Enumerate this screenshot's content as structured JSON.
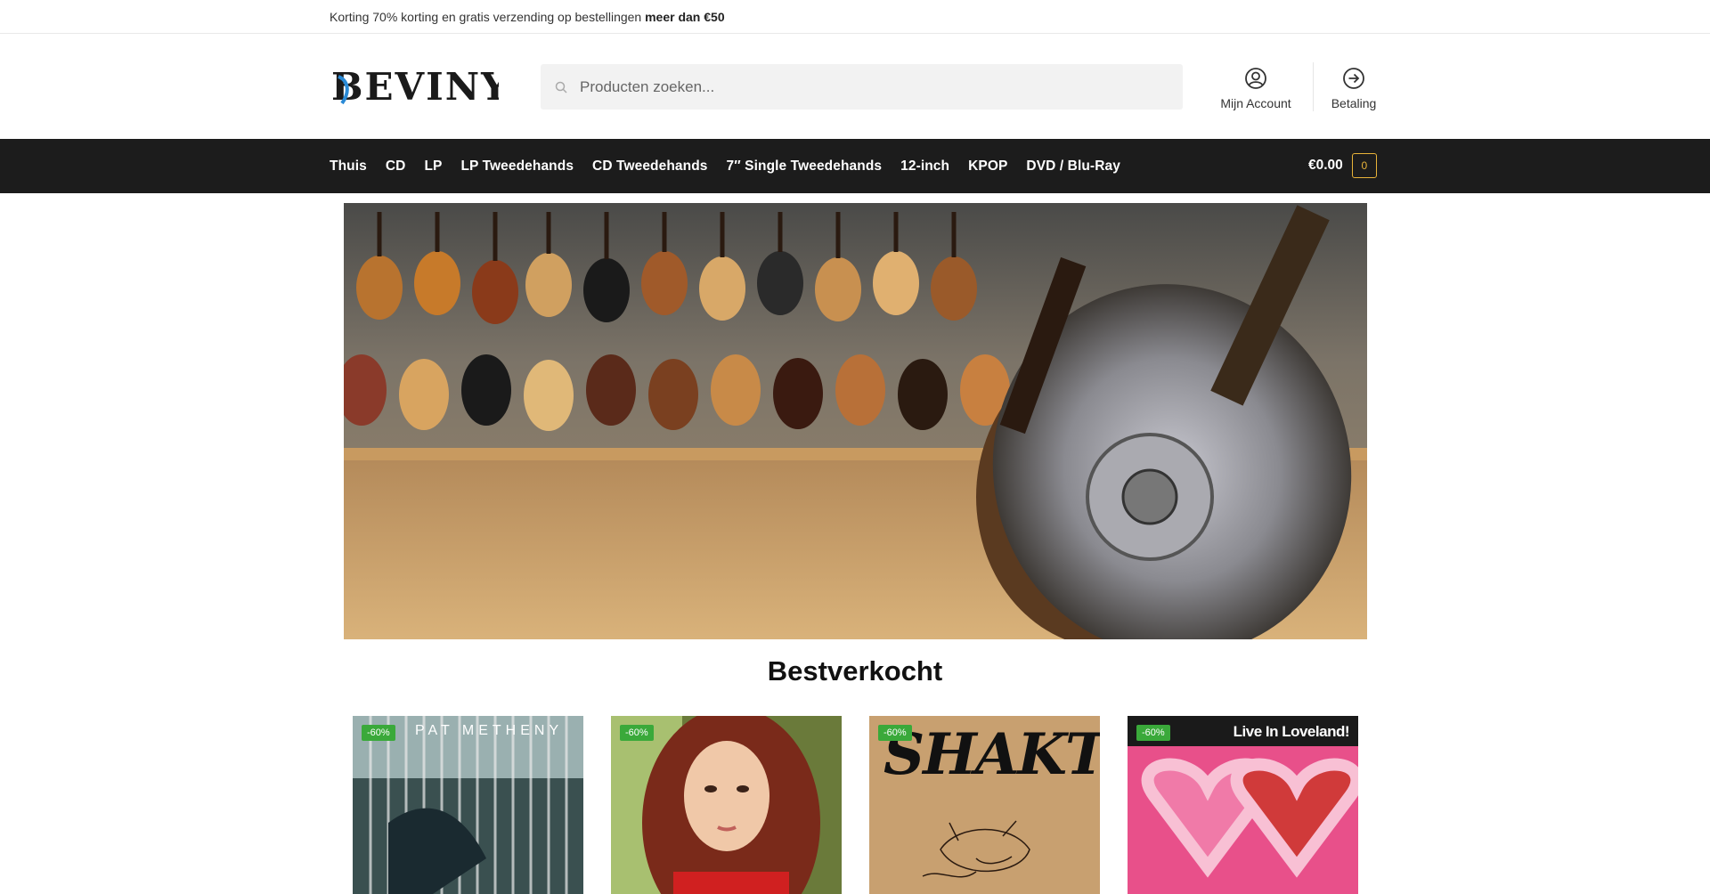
{
  "promo": {
    "text": "Korting 70% korting en gratis verzending op bestellingen ",
    "bold": "meer dan €50"
  },
  "header": {
    "logo_text": "BEVINYL",
    "search_placeholder": "Producten zoeken...",
    "account_label": "Mijn Account",
    "checkout_label": "Betaling"
  },
  "nav": {
    "items": [
      "Thuis",
      "CD",
      "LP",
      "LP Tweedehands",
      "CD Tweedehands",
      "7″ Single Tweedehands",
      "12-inch",
      "KPOP",
      "DVD / Blu-Ray"
    ],
    "cart_total": "€0.00",
    "cart_count": "0"
  },
  "section": {
    "title": "Bestverkocht"
  },
  "products": [
    {
      "badge": "-60%",
      "cover_text": "PAT METHENY",
      "cover_icon": "album-cover-pat-metheny"
    },
    {
      "badge": "-60%",
      "cover_text": "",
      "cover_icon": "album-cover-portrait"
    },
    {
      "badge": "-60%",
      "cover_text": "SHAKTI",
      "cover_icon": "album-cover-shakti"
    },
    {
      "badge": "-60%",
      "cover_text": "Live In Loveland!",
      "cover_icon": "album-cover-live-in-loveland"
    }
  ],
  "colors": {
    "nav_bg": "#1c1c1c",
    "cart_accent": "#e8b339",
    "badge_green": "#3aa93a"
  }
}
